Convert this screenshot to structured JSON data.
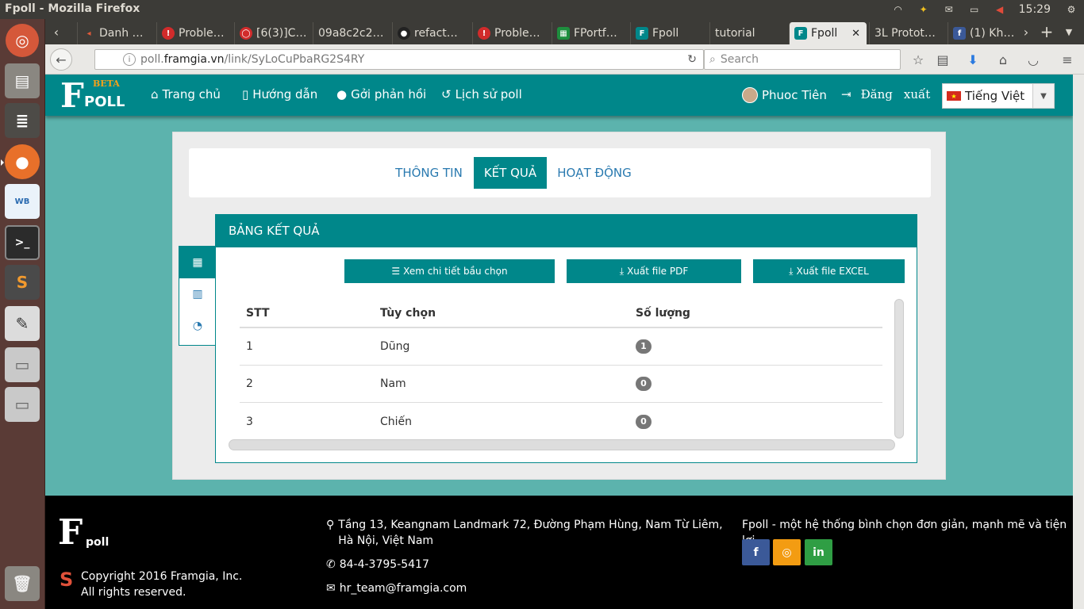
{
  "os": {
    "window_title": "Fpoll - Mozilla Firefox",
    "clock": "15:29"
  },
  "browser": {
    "tabs": [
      {
        "label": "Danh …",
        "favicon": "back-arrow-icon",
        "color": "#c0392b"
      },
      {
        "label": "Proble…",
        "favicon": "error-icon",
        "color": "#d12b2b"
      },
      {
        "label": "[6(3)]C…",
        "favicon": "chat-icon",
        "color": "#d12b2b"
      },
      {
        "label": "09a8c2c2…",
        "favicon": "",
        "color": ""
      },
      {
        "label": "refact…",
        "favicon": "github-icon",
        "color": "#333"
      },
      {
        "label": "Proble…",
        "favicon": "error-icon",
        "color": "#d12b2b"
      },
      {
        "label": "FPortf…",
        "favicon": "sheet-icon",
        "color": "#1e8e3e"
      },
      {
        "label": "Fpoll",
        "favicon": "fpoll-icon",
        "color": "#00878a"
      },
      {
        "label": "tutorial",
        "favicon": "",
        "color": ""
      },
      {
        "label": "Fpoll",
        "favicon": "fpoll-icon",
        "color": "#00878a",
        "active": true
      },
      {
        "label": "3L Protot…",
        "favicon": "",
        "color": ""
      },
      {
        "label": "(1) Kh…",
        "favicon": "facebook-icon",
        "color": "#3b5998"
      }
    ],
    "url_prefix": "poll.",
    "url_domain": "framgia.vn",
    "url_path": "/link/SyLoCuPbaRG2S4RY",
    "search_placeholder": "Search"
  },
  "app": {
    "logo_letter": "F",
    "logo_beta": "BETA",
    "logo_name": "POLL",
    "menu": {
      "home": "Trang chủ",
      "guide": "Hướng dẫn",
      "feedback": "Gởi phản hồi",
      "history": "Lịch sử poll"
    },
    "user_name": "Phuoc Tiên",
    "logout_word1": "Đăng",
    "logout_word2": "xuất",
    "language": "Tiếng Việt"
  },
  "tabs": {
    "info": "THÔNG TIN",
    "result": "KẾT QUẢ",
    "activity": "HOẠT ĐỘNG"
  },
  "result_panel": {
    "title": "BẢNG KẾT QUẢ",
    "btn_detail": "Xem chi tiết bầu chọn",
    "btn_pdf": "Xuất file PDF",
    "btn_excel": "Xuất file EXCEL",
    "columns": [
      "STT",
      "Tùy chọn",
      "Số lượng"
    ],
    "rows": [
      {
        "stt": "1",
        "option": "Dũng",
        "count": "1"
      },
      {
        "stt": "2",
        "option": "Nam",
        "count": "0"
      },
      {
        "stt": "3",
        "option": "Chiến",
        "count": "0"
      }
    ]
  },
  "footer": {
    "logo_letter": "F",
    "logo_name": "poll",
    "copyright": "Copyright 2016 Framgia, Inc.",
    "rights": "All rights reserved.",
    "address_line1": "Tầng 13, Keangnam Landmark 72, Đường Phạm Hùng, Nam Từ Liêm,",
    "address_line2": "Hà Nội, Việt Nam",
    "phone": "84-4-3795-5417",
    "email": "hr_team@framgia.com",
    "tagline": "Fpoll - một hệ thống bình chọn đơn giản, mạnh mẽ và tiện lợi"
  },
  "colors": {
    "brand": "#00878a",
    "background": "#5cb3ad",
    "link": "#2a7ab0"
  }
}
